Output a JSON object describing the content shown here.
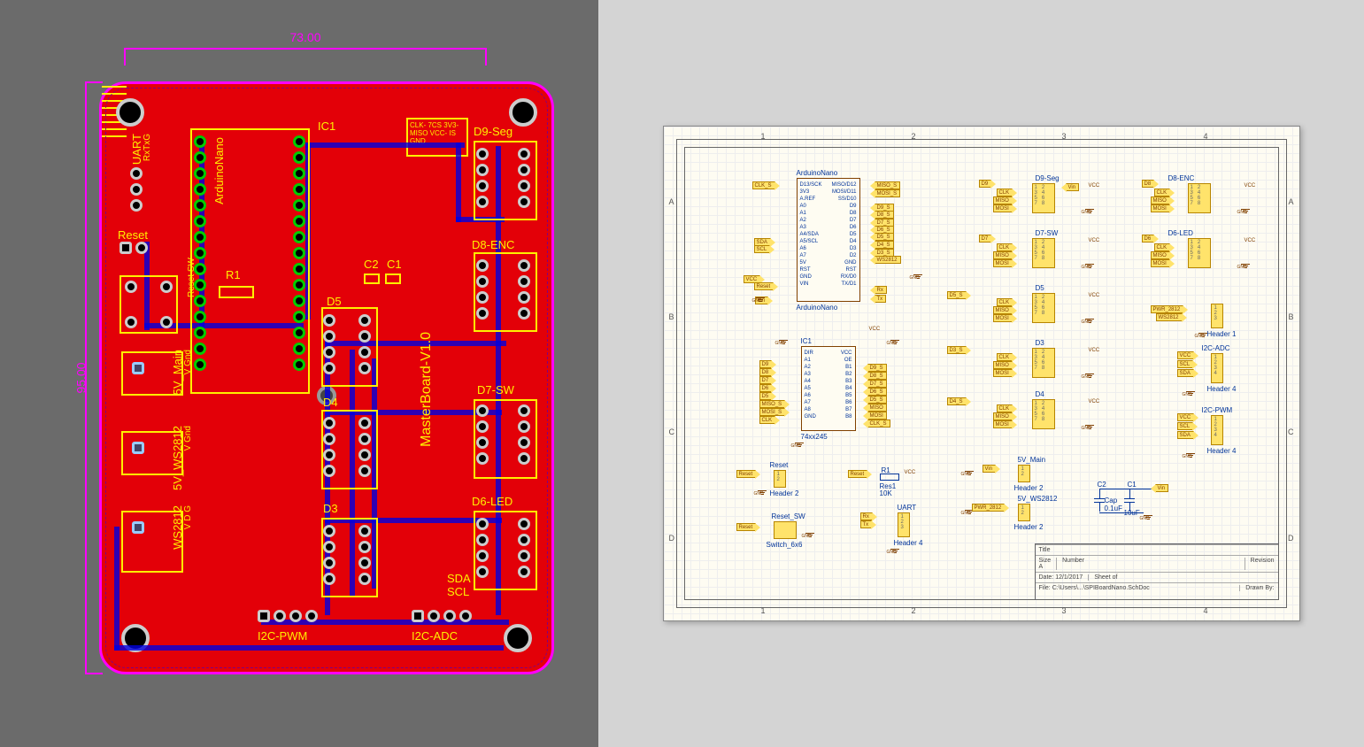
{
  "pcb": {
    "dim_h": "73.00",
    "dim_v": "95.00",
    "board_title": "MasterBoard-V1.0",
    "ic1": "IC1",
    "c1": "C1",
    "c2": "C2",
    "r1": "R1",
    "arduino": "ArduinoNano",
    "d9": "D9-Seg",
    "d8": "D8-ENC",
    "d7": "D7-SW",
    "d6": "D6-LED",
    "d5": "D5",
    "d4": "D4",
    "d3": "D3",
    "i2c_pwm": "I2C-PWM",
    "i2c_adc": "I2C-ADC",
    "sda": "SDA",
    "scl": "SCL",
    "reset": "Reset",
    "reset_sw": "Reset SW",
    "uart": "UART",
    "rxtxg": "RxTxG",
    "main5v": "5V_Main",
    "vgnd1": "V     Gnd",
    "ws5v": "5V_WS2812",
    "vgnd2": "V     Gnd",
    "ws": "WS2812",
    "vdg": "V  D  G",
    "silk_block": "CLK- 7CS\n3V3- MISO\nVCC- IS\nGND"
  },
  "sch": {
    "arduino_title": "ArduinoNano",
    "arduino_sub": "ArduinoNano",
    "ic1_title": "IC1",
    "ic1_sub": "74xx245",
    "arduino_pins_l": "D13/SCK\n3V3\nA.REF\nA0\nA1\nA2\nA3\nA4/SDA\nA5/SCL\nA6\nA7\n5V\nRST\nGND\nVIN",
    "arduino_pins_r": "MISO/D12\nMOSI/D11\nSS/D10\nD9\nD8\nD7\nD6\nD5\nD4\nD3\nD2\nGND\nRST\nRX/D0\nTX/D1",
    "ic1_pins_l": "DIR\nA1\nA2\nA3\nA4\nA5\nA6\nA7\nA8\nGND",
    "ic1_pins_r": "VCC\nOE\nB1\nB2\nB3\nB4\nB5\nB6\nB7\nB8",
    "nets": {
      "clk_s": "CLK_S",
      "sda": "SDA",
      "scl": "SCL",
      "vcc": "VCC",
      "reset": "Reset",
      "vin": "Vin",
      "miso_s": "MISO_S",
      "mosi_s": "MOSI_S",
      "clk": "CLK",
      "d9": "D9",
      "d8": "D8",
      "d7": "D7",
      "d6": "D6",
      "d5": "D5",
      "d4": "D4",
      "d3": "D3",
      "d9s": "D9_S",
      "d8s": "D8_S",
      "d7s": "D7_S",
      "d6s": "D6_S",
      "d5s": "D5_S",
      "d4s": "D4_S",
      "d3s": "D3_S",
      "rx": "Rx",
      "tx": "Tx",
      "miso": "MISO",
      "mosi": "MOSI",
      "ws2812": "WS2812",
      "pwr2812": "PWR_2812"
    },
    "headers": {
      "d9seg": "D9-Seg",
      "d8enc": "D8-ENC",
      "d7sw": "D7-SW",
      "d6led": "D6-LED",
      "d5": "D5",
      "d4": "D4",
      "d3": "D3",
      "d8": "D8",
      "d6": "D6",
      "reset_h": "Reset",
      "reset_sw": "Reset_SW",
      "uart": "UART",
      "main5v": "5V_Main",
      "ws5v": "5V_WS2812",
      "i2c_adc": "I2C-ADC",
      "i2c_pwm": "I2C-PWM",
      "header1": "Header 1",
      "header2": "Header 2",
      "header4": "Header 4",
      "switch": "Switch_6x6",
      "res1": "Res1",
      "r_val": "10K",
      "r_ref": "R1",
      "c2_ref": "C2",
      "c2_val": "Cap\n0.1uF",
      "c1_ref": "C1",
      "c1_val": "10uF"
    },
    "gnd": "GND",
    "zones_h": [
      "1",
      "2",
      "3",
      "4"
    ],
    "zones_v": [
      "A",
      "B",
      "C",
      "D"
    ],
    "title_block": {
      "title": "Title",
      "size": "Size",
      "size_v": "A",
      "number": "Number",
      "revision": "Revision",
      "date": "Date:",
      "date_v": "12/1/2017",
      "sheet": "Sheet   of",
      "file": "File:",
      "file_v": "C:\\Users\\...\\SPIBoardNano.SchDoc",
      "drawn": "Drawn By:"
    }
  }
}
